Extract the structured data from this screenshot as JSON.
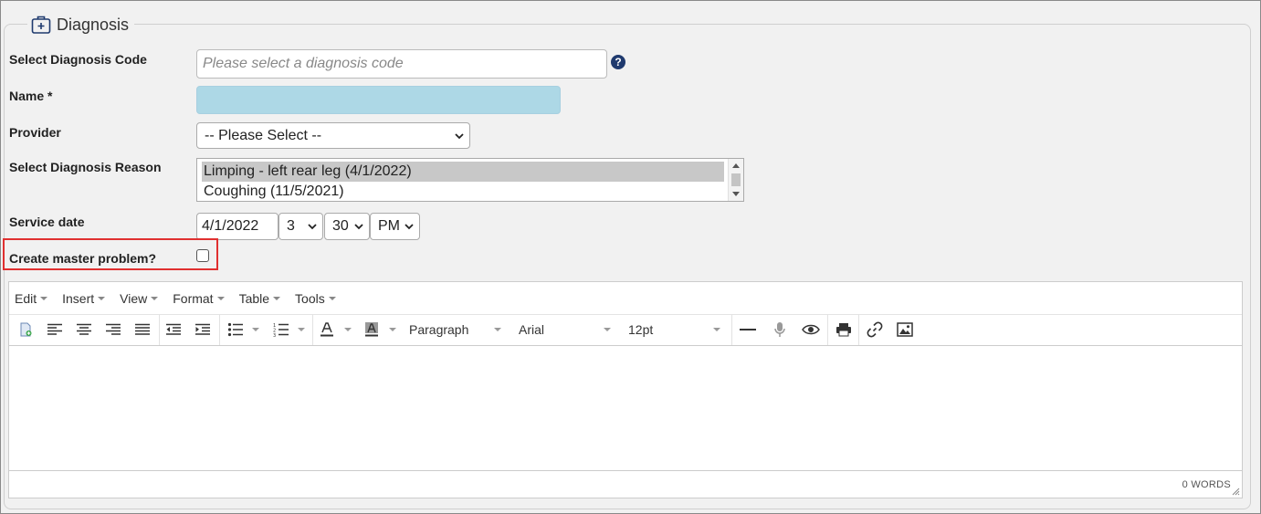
{
  "section": {
    "title": "Diagnosis",
    "icon": "medical-kit-icon"
  },
  "fields": {
    "diagnosis_code": {
      "label": "Select Diagnosis Code",
      "placeholder": "Please select a diagnosis code",
      "value": ""
    },
    "name": {
      "label": "Name *",
      "value": ""
    },
    "provider": {
      "label": "Provider",
      "selected": "-- Please Select --"
    },
    "reason": {
      "label": "Select Diagnosis Reason",
      "options": [
        "Limping - left rear leg (4/1/2022)",
        "Coughing (11/5/2021)"
      ],
      "selected_index": 0
    },
    "service_date": {
      "label": "Service date",
      "date": "4/1/2022",
      "hour": "3",
      "minute": "30",
      "ampm": "PM"
    },
    "master_problem": {
      "label": "Create master problem?",
      "checked": false
    }
  },
  "editor": {
    "menus": [
      "Edit",
      "Insert",
      "View",
      "Format",
      "Table",
      "Tools"
    ],
    "block_format": "Paragraph",
    "font_family": "Arial",
    "font_size": "12pt",
    "word_count": "0 WORDS"
  },
  "colors": {
    "name_field_bg": "#add8e6",
    "highlight": "#e03030",
    "help_icon": "#1f3a6e"
  }
}
